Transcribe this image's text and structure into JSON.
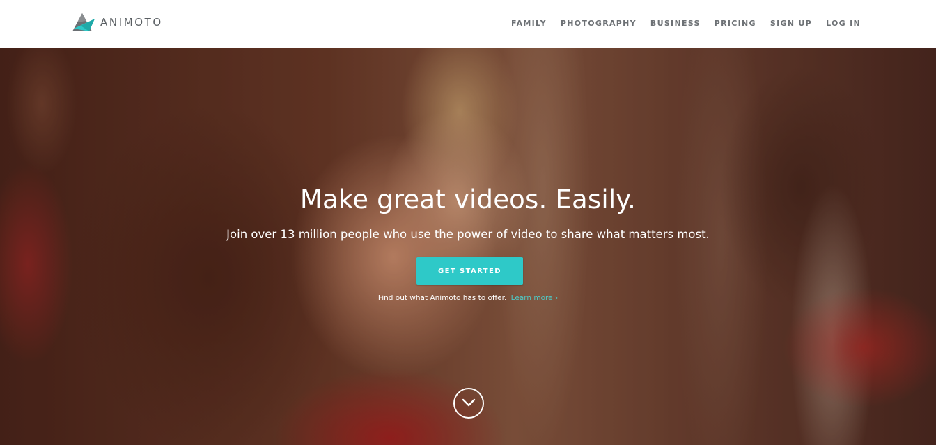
{
  "brand": {
    "name": "ANIMOTO",
    "logo_icon": "animoto-triangle-logo-icon",
    "accent_color": "#2ec9c8"
  },
  "nav": {
    "items": [
      {
        "label": "FAMILY"
      },
      {
        "label": "PHOTOGRAPHY"
      },
      {
        "label": "BUSINESS"
      },
      {
        "label": "PRICING"
      },
      {
        "label": "SIGN UP"
      },
      {
        "label": "LOG IN"
      }
    ]
  },
  "hero": {
    "headline": "Make great videos. Easily.",
    "subheadline": "Join over 13 million people who use the power of video to share what matters most.",
    "cta_label": "GET STARTED",
    "findout_text": "Find out what Animoto has to offer.",
    "learn_more_label": "Learn more ›",
    "scroll_icon": "chevron-down-circle-icon",
    "background_image": "two-smiling-women-photo"
  }
}
